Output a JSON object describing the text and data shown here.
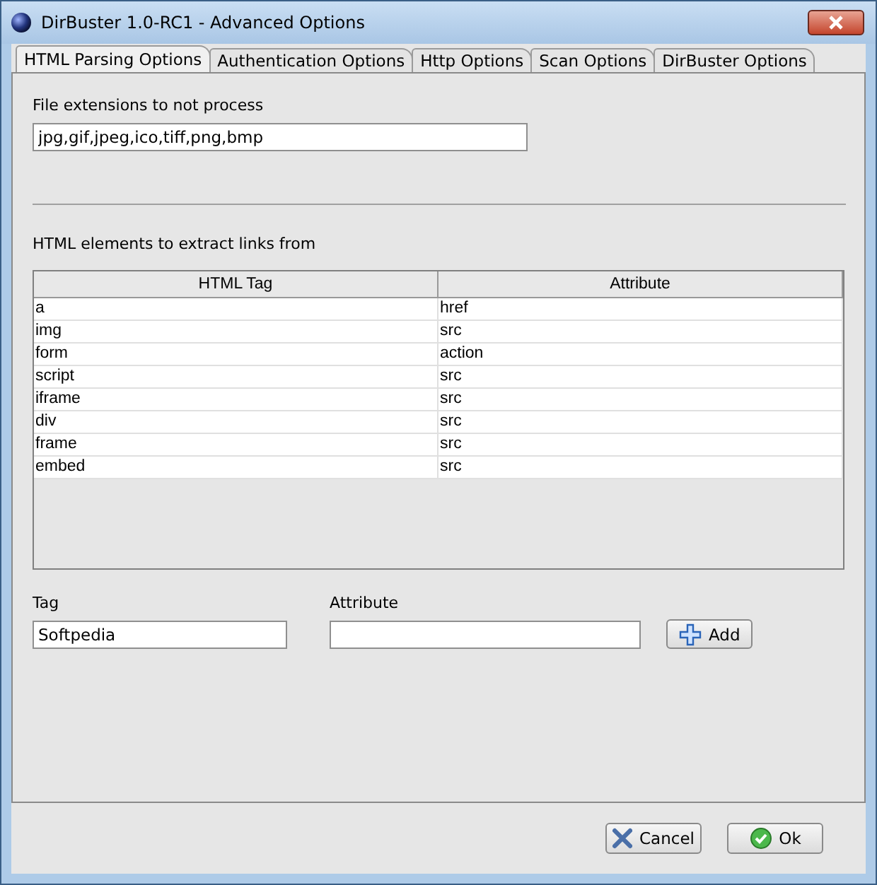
{
  "window": {
    "title": "DirBuster 1.0-RC1 - Advanced Options"
  },
  "tabs": [
    {
      "label": "HTML Parsing Options",
      "selected": true
    },
    {
      "label": "Authentication Options",
      "selected": false
    },
    {
      "label": "Http Options",
      "selected": false
    },
    {
      "label": "Scan Options",
      "selected": false
    },
    {
      "label": "DirBuster Options",
      "selected": false
    }
  ],
  "extensions": {
    "label": "File extensions to not process",
    "value": "jpg,gif,jpeg,ico,tiff,png,bmp"
  },
  "elements_label": "HTML elements to extract links from",
  "table": {
    "columns": [
      "HTML Tag",
      "Attribute"
    ],
    "rows": [
      [
        "a",
        "href"
      ],
      [
        "img",
        "src"
      ],
      [
        "form",
        "action"
      ],
      [
        "script",
        "src"
      ],
      [
        "iframe",
        "src"
      ],
      [
        "div",
        "src"
      ],
      [
        "frame",
        "src"
      ],
      [
        "embed",
        "src"
      ]
    ]
  },
  "tag_field": {
    "label": "Tag",
    "value": "Softpedia"
  },
  "attribute_field": {
    "label": "Attribute"
  },
  "add_button": "Add",
  "buttons": [
    {
      "label": "Cancel",
      "kind": "cancel"
    },
    {
      "label": "Ok",
      "kind": "ok"
    }
  ]
}
